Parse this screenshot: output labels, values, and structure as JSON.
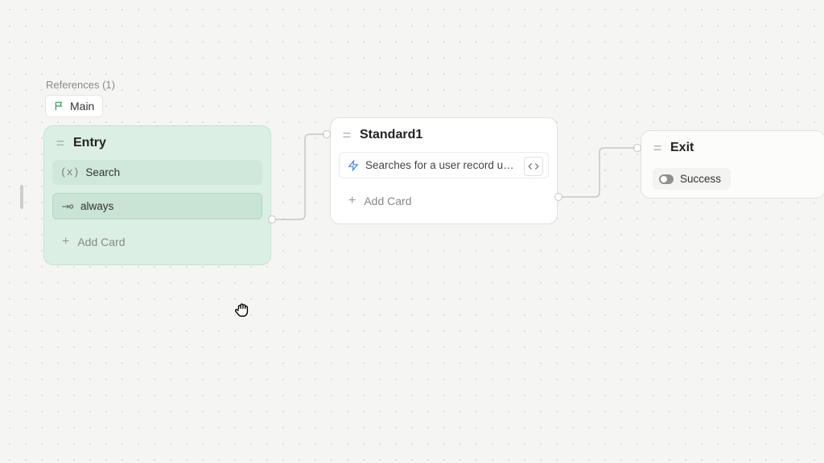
{
  "references": {
    "label": "References (1)",
    "main_label": "Main"
  },
  "nodes": {
    "entry": {
      "title": "Entry",
      "search_card": "Search",
      "always_card": "always",
      "add_card": "Add Card"
    },
    "standard": {
      "title": "Standard1",
      "action_card": "Searches for a user record usi...",
      "add_card": "Add Card"
    },
    "exit": {
      "title": "Exit",
      "success_card": "Success"
    }
  }
}
